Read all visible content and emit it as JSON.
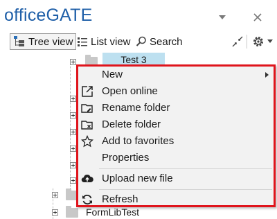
{
  "app": {
    "title": "officeGATE"
  },
  "toolbar": {
    "tree_view": "Tree view",
    "list_view": "List view",
    "search": "Search"
  },
  "tree": {
    "selected_node": "Test 3",
    "visible_label": "FormLibTest"
  },
  "context_menu": {
    "items": [
      {
        "label": "New",
        "icon": "none",
        "submenu": true
      },
      {
        "label": "Open online",
        "icon": "external-link-icon"
      },
      {
        "label": "Rename folder",
        "icon": "rename-folder-icon"
      },
      {
        "label": "Delete folder",
        "icon": "delete-folder-icon"
      },
      {
        "label": "Add to favorites",
        "icon": "star-icon"
      },
      {
        "label": "Properties",
        "icon": "none"
      },
      {
        "label": "Upload new file",
        "icon": "upload-cloud-icon"
      },
      {
        "label": "Refresh",
        "icon": "refresh-icon"
      }
    ]
  },
  "colors": {
    "title": "#1f5fa8",
    "highlight_border": "#e0141c",
    "selection": "#bde0f0"
  }
}
